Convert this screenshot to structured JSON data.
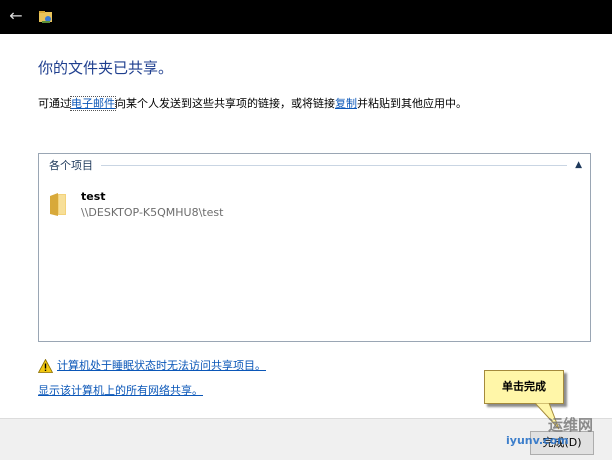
{
  "heading": "你的文件夹已共享。",
  "info_line": {
    "prefix": "可通过",
    "email_link": "电子邮件",
    "middle": "向某个人发送到这些共享项的链接，或将链接",
    "copy_link": "复制",
    "suffix": "并粘贴到其他应用中。"
  },
  "items_group": {
    "header": "各个项目",
    "items": [
      {
        "name": "test",
        "path": "\\\\DESKTOP-K5QMHU8\\test"
      }
    ]
  },
  "warning_link": "计算机处于睡眠状态时无法访问共享项目。",
  "show_shares_link": "显示该计算机上的所有网络共享。",
  "done_button": "完成(D)",
  "callout": "单击完成",
  "watermark": {
    "main": "运维网",
    "url": "iyunv.com"
  },
  "colors": {
    "heading": "#1f3f8f",
    "link": "#0b57b8",
    "titlebar": "#000000",
    "callout_bg": "#fff6a8"
  }
}
